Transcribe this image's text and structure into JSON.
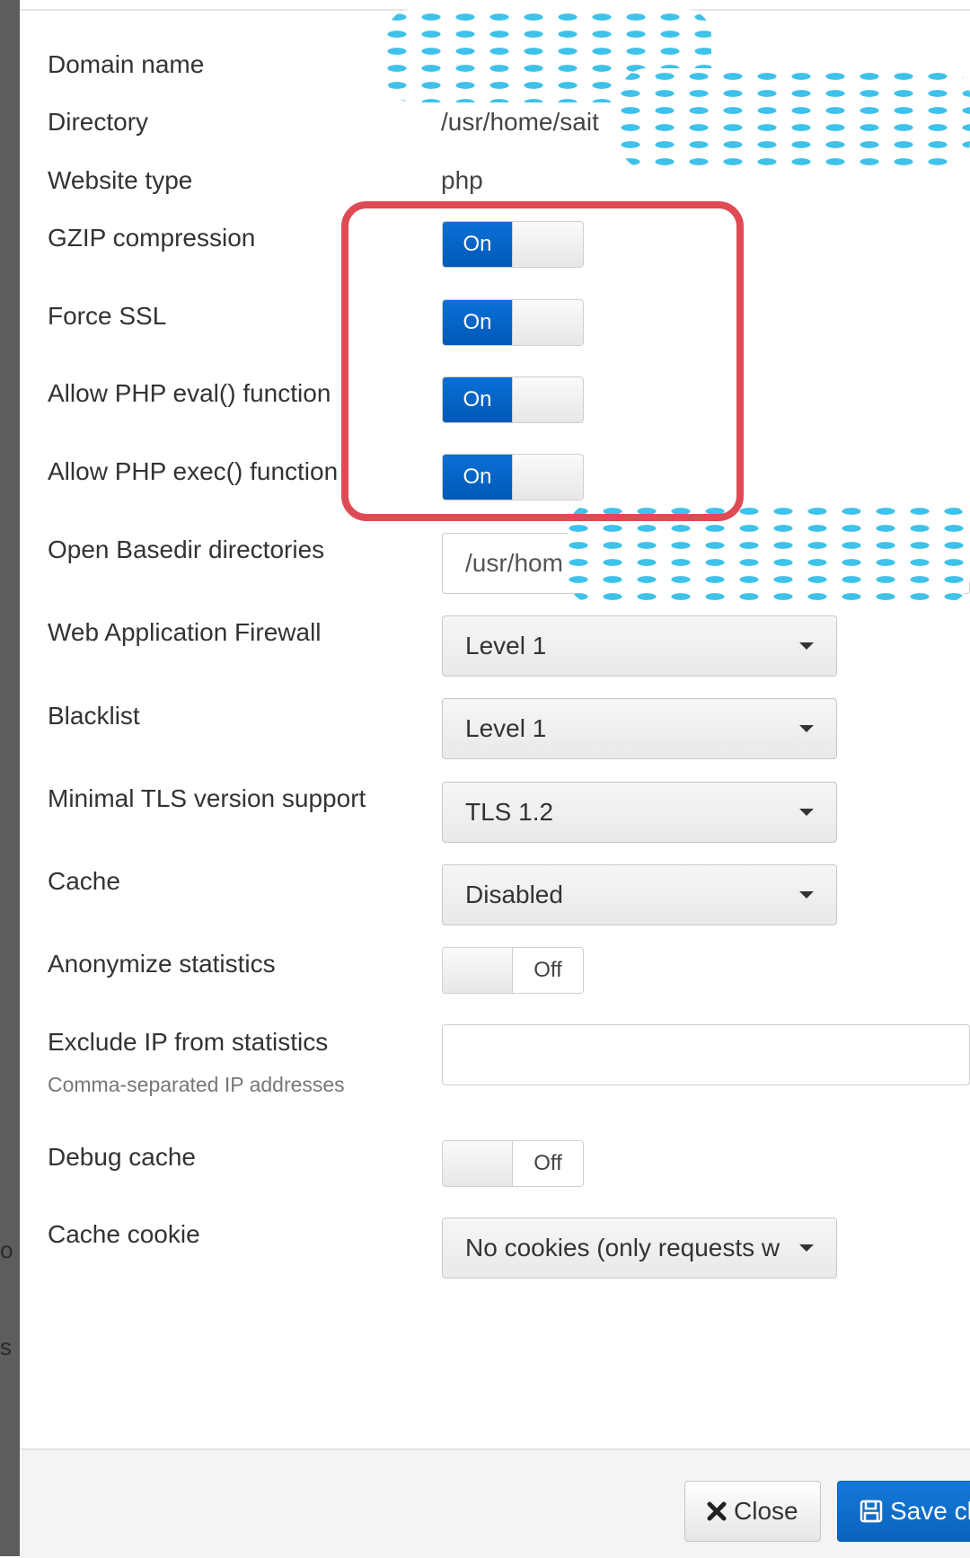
{
  "background": {
    "ghost_text_1": "o",
    "ghost_text_2": "s"
  },
  "form": {
    "domain_name": {
      "label": "Domain name",
      "value": ""
    },
    "directory": {
      "label": "Directory",
      "value": "/usr/home/sait"
    },
    "website_type": {
      "label": "Website type",
      "value": "php"
    },
    "gzip": {
      "label": "GZIP compression",
      "state": "On"
    },
    "force_ssl": {
      "label": "Force SSL",
      "state": "On"
    },
    "php_eval": {
      "label": "Allow PHP eval() function",
      "state": "On"
    },
    "php_exec": {
      "label": "Allow PHP exec() function",
      "state": "On"
    },
    "open_basedir": {
      "label": "Open Basedir directories",
      "value": "/usr/hom"
    },
    "waf": {
      "label": "Web Application Firewall",
      "value": "Level 1"
    },
    "blacklist": {
      "label": "Blacklist",
      "value": "Level 1"
    },
    "min_tls": {
      "label": "Minimal TLS version support",
      "value": "TLS 1.2"
    },
    "cache": {
      "label": "Cache",
      "value": "Disabled"
    },
    "anonymize": {
      "label": "Anonymize statistics",
      "state": "Off"
    },
    "exclude_ip": {
      "label": "Exclude IP from statistics",
      "hint": "Comma-separated IP addresses",
      "value": ""
    },
    "debug_cache": {
      "label": "Debug cache",
      "state": "Off"
    },
    "cache_cookie": {
      "label": "Cache cookie",
      "value": "No cookies (only requests w"
    }
  },
  "footer": {
    "close_label": "Close",
    "save_label": "Save ch"
  },
  "colors": {
    "toggle_on": "#0a6fd3",
    "highlight_box": "#e04a55",
    "redaction_blue": "#3ec2ea",
    "redaction_purple": "#a98fd0"
  }
}
